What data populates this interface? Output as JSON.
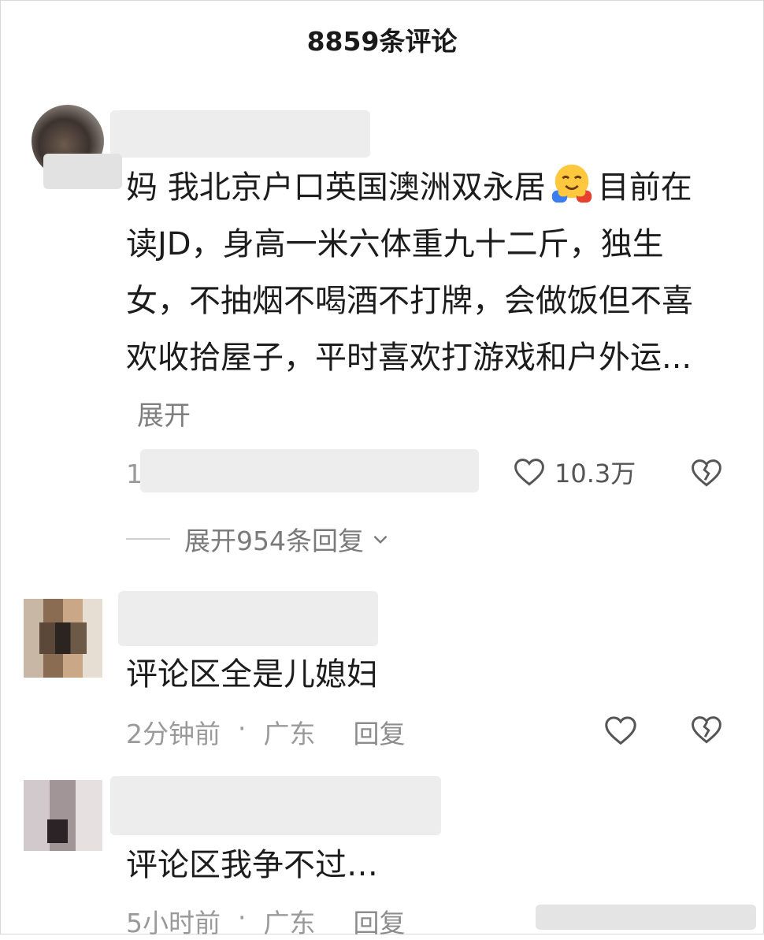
{
  "header": {
    "title": "8859条评论"
  },
  "comments": [
    {
      "text_before_emoji": "妈 我北京户口英国澳洲双永居",
      "text_after_emoji": "目前在读JD，身高一米六体重九十二斤，独生女，不抽烟不喝酒不打牌，会做饭但不喜欢收拾屋子，平时喜欢打游戏和户外运...",
      "expand_label": "展开",
      "meta_visible": "1",
      "like_count": "10.3万",
      "replies_label": "展开954条回复"
    },
    {
      "text": "评论区全是儿媳妇",
      "time": "2分钟前",
      "location": "广东",
      "reply_label": "回复",
      "separator": "·"
    },
    {
      "text": "评论区我争不过…",
      "time": "5小时前",
      "location": "广东",
      "reply_label": "回复",
      "separator": "·"
    }
  ],
  "icons": {
    "like": "heart-outline-icon",
    "dislike": "broken-heart-icon",
    "expand_replies": "chevron-down-icon",
    "emoji": "hugging-face-emoji"
  }
}
